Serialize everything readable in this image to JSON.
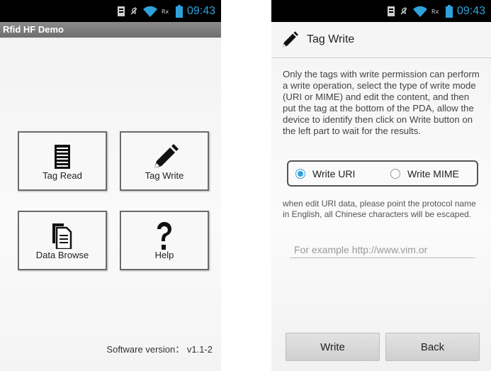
{
  "status_bar": {
    "time": "09:43",
    "icons": [
      "sim-icon",
      "no-mute-icon",
      "wifi-icon",
      "network-icon",
      "battery-icon"
    ],
    "accent_color": "#2fa2dc"
  },
  "left_screen": {
    "app_title": "Rfid HF Demo",
    "tiles": [
      {
        "label": "Tag Read",
        "icon": "list-document-icon"
      },
      {
        "label": "Tag Write",
        "icon": "pen-icon"
      },
      {
        "label": "Data Browse",
        "icon": "documents-copy-icon"
      },
      {
        "label": "Help",
        "icon": "question-mark-icon"
      }
    ],
    "software_version": "Software version： v1.1-2"
  },
  "right_screen": {
    "title": "Tag Write",
    "title_icon": "pen-icon",
    "description": "Only the tags with write permission can perform a write operation, select the type of write mode (URI or MIME) and edit the content, and then put the tag at the bottom of the PDA, allow the device to identify then click on Write button on the left part to wait for the results.",
    "write_mode": {
      "options": [
        "Write URI",
        "Write MIME"
      ],
      "selected": "Write URI"
    },
    "hint": "when edit URI data, please point the protocol name in English, all Chinese characters will be escaped.",
    "input": {
      "value": "",
      "placeholder": "For example http://www.vim.or"
    },
    "buttons": {
      "write": "Write",
      "back": "Back"
    }
  }
}
